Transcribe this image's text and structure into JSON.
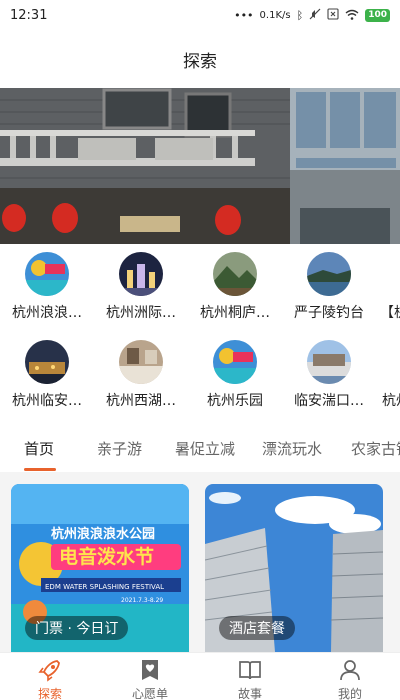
{
  "status_bar": {
    "time": "12:31",
    "network_speed": "0.1K/s",
    "battery": "100",
    "icons": [
      "dots-icon",
      "bluetooth-icon",
      "mute-icon",
      "close-box-icon",
      "wifi-icon",
      "battery-icon"
    ]
  },
  "header": {
    "title": "探索"
  },
  "banner": {
    "sign_text": ""
  },
  "destinations_row1": [
    {
      "label": "杭州浪浪…",
      "icon": "waterpark-thumb"
    },
    {
      "label": "杭州洲际…",
      "icon": "night-city-thumb"
    },
    {
      "label": "杭州桐庐…",
      "icon": "mountain-thumb"
    },
    {
      "label": "严子陵钓台",
      "icon": "lake-thumb"
    },
    {
      "label": "【杭",
      "icon": "cut-off-thumb"
    }
  ],
  "destinations_row2": [
    {
      "label": "杭州临安…",
      "icon": "town-night-thumb"
    },
    {
      "label": "杭州西湖…",
      "icon": "hotel-room-thumb"
    },
    {
      "label": "杭州乐园",
      "icon": "waterpark-thumb"
    },
    {
      "label": "临安湍口…",
      "icon": "resort-thumb"
    },
    {
      "label": "杭州",
      "icon": "cut-off-thumb"
    }
  ],
  "tabs": [
    "首页",
    "亲子游",
    "暑促立减",
    "漂流玩水",
    "农家古镇"
  ],
  "active_tab": "首页",
  "cards": [
    {
      "tag": "门票 · 今日订",
      "poster_title": "杭州浪浪浪水公园",
      "poster_subtitle": "电音泼水节",
      "poster_english": "EDM WATER SPLASHING FESTIVAL",
      "poster_date": "2021.7.3-8.29"
    },
    {
      "tag": "酒店套餐"
    }
  ],
  "bottom_nav": [
    {
      "label": "探索",
      "icon": "rocket-icon",
      "active": true
    },
    {
      "label": "心愿单",
      "icon": "wishlist-heart-icon",
      "active": false
    },
    {
      "label": "故事",
      "icon": "book-icon",
      "active": false
    },
    {
      "label": "我的",
      "icon": "user-icon",
      "active": false
    }
  ],
  "colors": {
    "accent": "#e8622c",
    "battery": "#3cb24a"
  }
}
